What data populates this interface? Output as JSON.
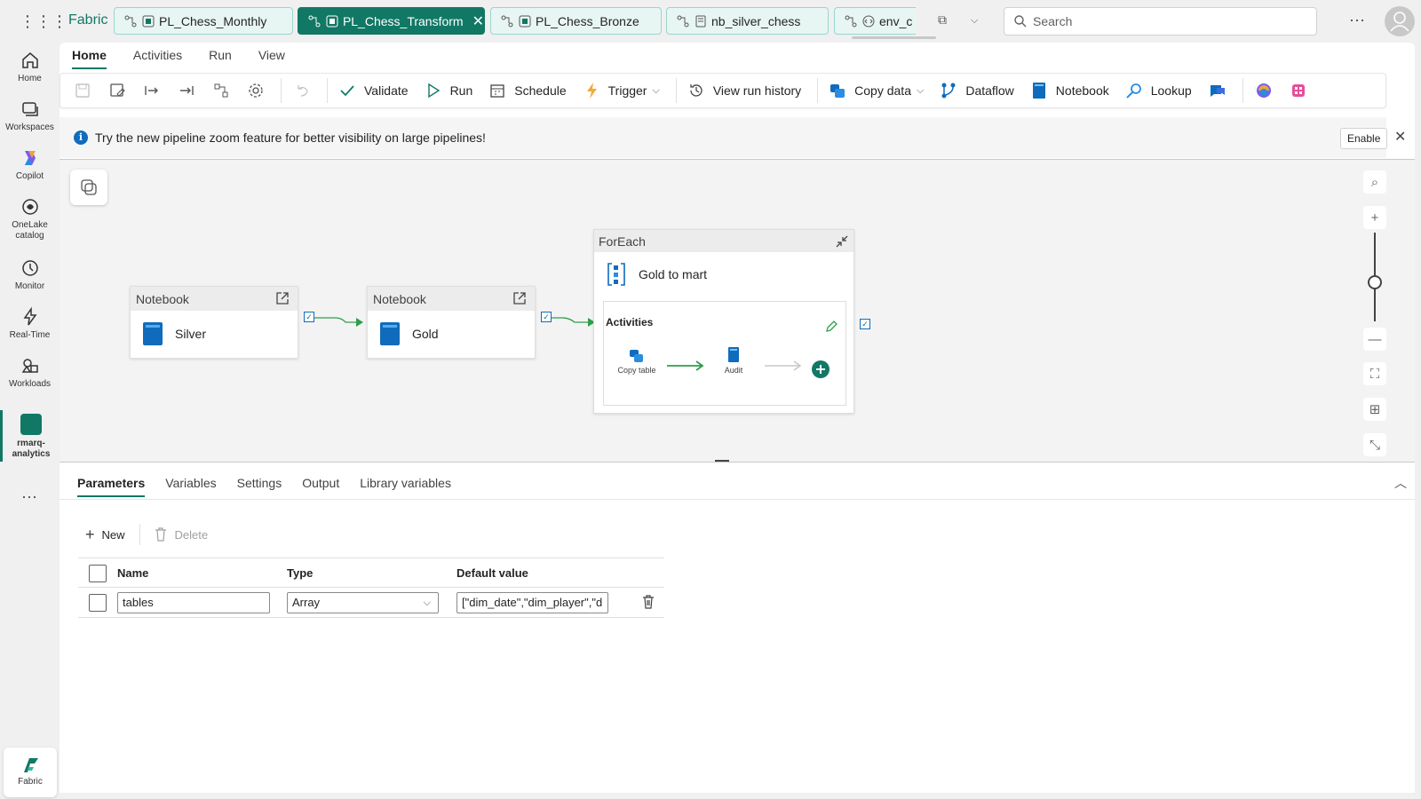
{
  "rail": {
    "items": [
      {
        "label": "Home"
      },
      {
        "label": "Workspaces"
      },
      {
        "label": "Copilot"
      },
      {
        "label": "OneLake catalog"
      },
      {
        "label": "Monitor"
      },
      {
        "label": "Real-Time"
      },
      {
        "label": "Workloads"
      },
      {
        "label": "rmarq-analytics"
      }
    ],
    "more": "...",
    "fabric_label": "Fabric"
  },
  "topbar": {
    "brand": "Fabric",
    "tabs": [
      {
        "label": "PL_Chess_Monthly"
      },
      {
        "label": "PL_Chess_Transform"
      },
      {
        "label": "PL_Chess_Bronze"
      },
      {
        "label": "nb_silver_chess"
      },
      {
        "label": "env_c"
      }
    ],
    "search_placeholder": "Search",
    "more": "···"
  },
  "menu": {
    "tabs": [
      "Home",
      "Activities",
      "Run",
      "View"
    ]
  },
  "toolbar": {
    "validate": "Validate",
    "run": "Run",
    "schedule": "Schedule",
    "trigger": "Trigger",
    "view_run_history": "View run history",
    "copy_data": "Copy data",
    "dataflow": "Dataflow",
    "notebook": "Notebook",
    "lookup": "Lookup"
  },
  "info": {
    "message": "Try the new pipeline zoom feature for better visibility on large pipelines!",
    "enable": "Enable"
  },
  "canvas": {
    "silver": {
      "type": "Notebook",
      "name": "Silver"
    },
    "gold": {
      "type": "Notebook",
      "name": "Gold"
    },
    "foreach": {
      "type": "ForEach",
      "name": "Gold to mart",
      "activities_label": "Activities",
      "inner": [
        "Copy table",
        "Audit"
      ]
    }
  },
  "panel": {
    "tabs": [
      "Parameters",
      "Variables",
      "Settings",
      "Output",
      "Library variables"
    ],
    "new": "New",
    "delete": "Delete",
    "columns": [
      "Name",
      "Type",
      "Default value"
    ],
    "rows": [
      {
        "name": "tables",
        "type": "Array",
        "default": "[\"dim_date\",\"dim_player\",\"d"
      }
    ]
  },
  "colors": {
    "accent": "#117865",
    "notebook_blue": "#0f6cbd",
    "connector_green": "#2e9e4a"
  }
}
